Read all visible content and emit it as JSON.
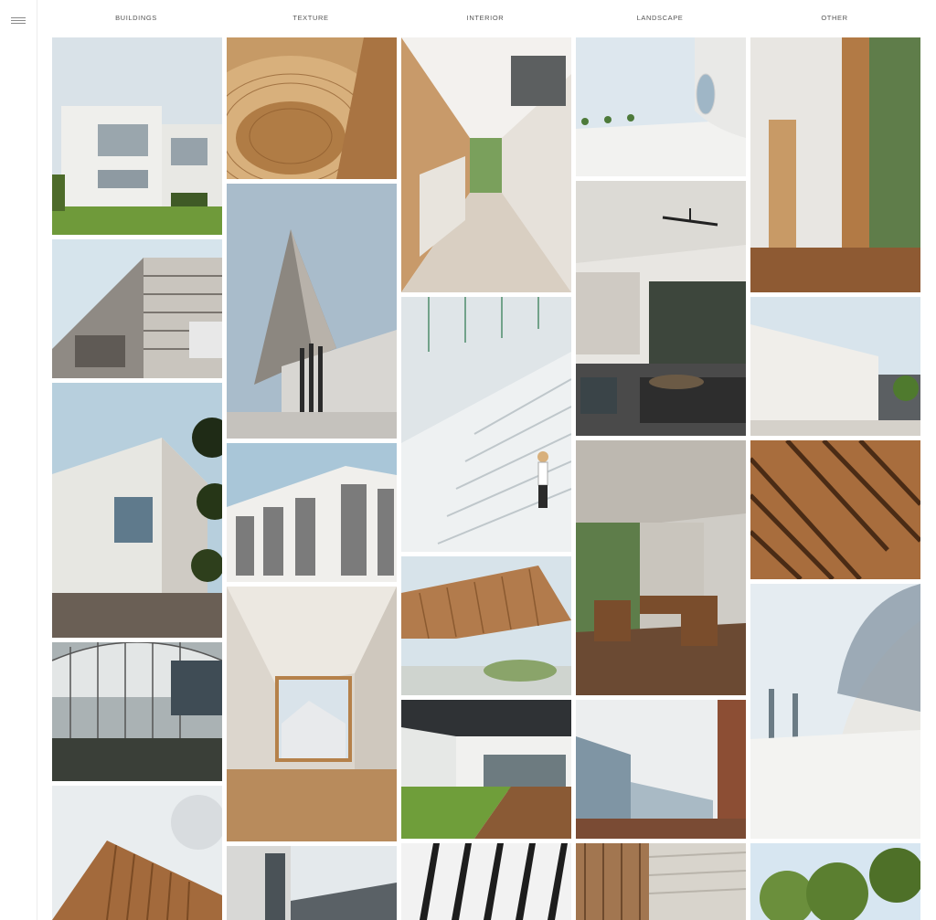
{
  "nav": {
    "menu_icon": "hamburger-menu-icon",
    "items": [
      {
        "label": "BUILDINGS"
      },
      {
        "label": "TEXTURE"
      },
      {
        "label": "INTERIOR"
      },
      {
        "label": "LANDSCAPE"
      },
      {
        "label": "OTHER"
      }
    ]
  },
  "gallery": {
    "columns": [
      {
        "category": "BUILDINGS",
        "tiles": [
          "white-villa",
          "striped-facade",
          "white-block-trees",
          "glass-dome-atrium",
          "timber-slat-building"
        ]
      },
      {
        "category": "TEXTURE",
        "tiles": [
          "curved-wood-ceiling",
          "concrete-spike",
          "louvered-facade",
          "wood-frame-window-room",
          "dark-tower-facade"
        ]
      },
      {
        "category": "INTERIOR",
        "tiles": [
          "kitchen-corridor",
          "white-staircase",
          "timber-canopy",
          "courtyard-lawn",
          "black-slats"
        ]
      },
      {
        "category": "LANDSCAPE",
        "tiles": [
          "plaza-round-window",
          "living-room-fan",
          "concrete-terrace",
          "glass-office",
          "wood-deck"
        ]
      },
      {
        "category": "OTHER",
        "tiles": [
          "window-nook",
          "white-wall-building",
          "wood-diagonal",
          "curved-canopy",
          "trees"
        ]
      }
    ]
  },
  "colors": {
    "nav_text": "#555555",
    "sky": "#cfdde6",
    "wood": "#b9875a",
    "concrete": "#cfcac3"
  }
}
